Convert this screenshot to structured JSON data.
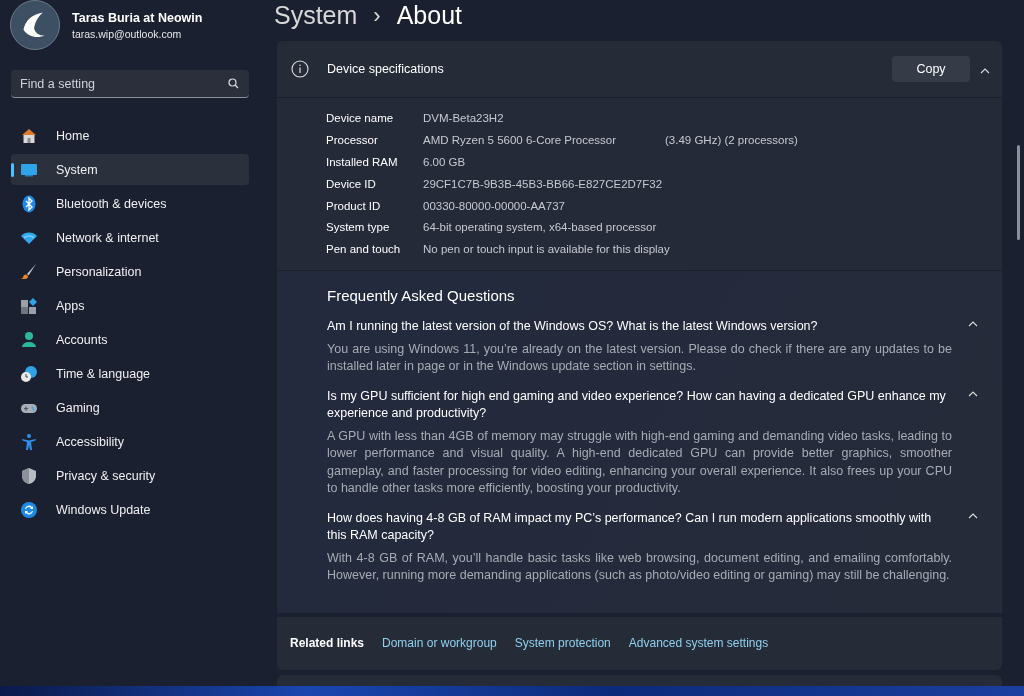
{
  "account": {
    "name": "Taras Buria at Neowin",
    "email": "taras.wip@outlook.com"
  },
  "search": {
    "placeholder": "Find a setting"
  },
  "nav": [
    {
      "label": "Home",
      "selected": false
    },
    {
      "label": "System",
      "selected": true
    },
    {
      "label": "Bluetooth & devices",
      "selected": false
    },
    {
      "label": "Network & internet",
      "selected": false
    },
    {
      "label": "Personalization",
      "selected": false
    },
    {
      "label": "Apps",
      "selected": false
    },
    {
      "label": "Accounts",
      "selected": false
    },
    {
      "label": "Time & language",
      "selected": false
    },
    {
      "label": "Gaming",
      "selected": false
    },
    {
      "label": "Accessibility",
      "selected": false
    },
    {
      "label": "Privacy & security",
      "selected": false
    },
    {
      "label": "Windows Update",
      "selected": false
    }
  ],
  "breadcrumb": {
    "parent": "System",
    "separator": "›",
    "current": "About"
  },
  "specs": {
    "title": "Device specifications",
    "copy_button": "Copy",
    "expanded": true,
    "rows": [
      {
        "label": "Device name",
        "value": "DVM-Beta23H2"
      },
      {
        "label": "Processor",
        "value": "AMD Ryzen 5 5600 6-Core Processor",
        "extra": "(3.49 GHz) (2 processors)"
      },
      {
        "label": "Installed RAM",
        "value": "6.00 GB"
      },
      {
        "label": "Device ID",
        "value": "29CF1C7B-9B3B-45B3-BB66-E827CE2D7F32"
      },
      {
        "label": "Product ID",
        "value": "00330-80000-00000-AA737"
      },
      {
        "label": "System type",
        "value": "64-bit operating system, x64-based processor"
      },
      {
        "label": "Pen and touch",
        "value": "No pen or touch input is available for this display"
      }
    ]
  },
  "faq": {
    "title": "Frequently Asked Questions",
    "items": [
      {
        "question": "Am I running the latest version of the Windows OS? What is the latest Windows version?",
        "answer": "You are using Windows 11, you’re already on the latest version. Please do check if there are any updates to be installed later in page or in the Windows update section in settings.",
        "expanded": true
      },
      {
        "question": "Is my GPU sufficient for high end gaming and video experience? How can having a dedicated GPU enhance my experience and productivity?",
        "answer": "A GPU with less than 4GB of memory may struggle with high-end gaming and demanding video tasks, leading to lower performance and visual quality. A high-end dedicated GPU can provide better graphics, smoother gameplay, and faster processing for video editing, enhancing your overall experience. It also frees up your CPU to handle other tasks more efficiently, boosting your productivity.",
        "expanded": true
      },
      {
        "question": "How does having 4-8 GB of RAM impact my PC’s performance? Can I run modern applications smoothly with this RAM capacity?",
        "answer": "With 4-8 GB of RAM, you’ll handle basic tasks like web browsing, document editing, and emailing comfortably. However, running more demanding applications (such as photo/video editing or gaming) may still be challenging.",
        "expanded": true
      }
    ]
  },
  "related": {
    "title": "Related links",
    "links": [
      "Domain or workgroup",
      "System protection",
      "Advanced system settings"
    ]
  }
}
